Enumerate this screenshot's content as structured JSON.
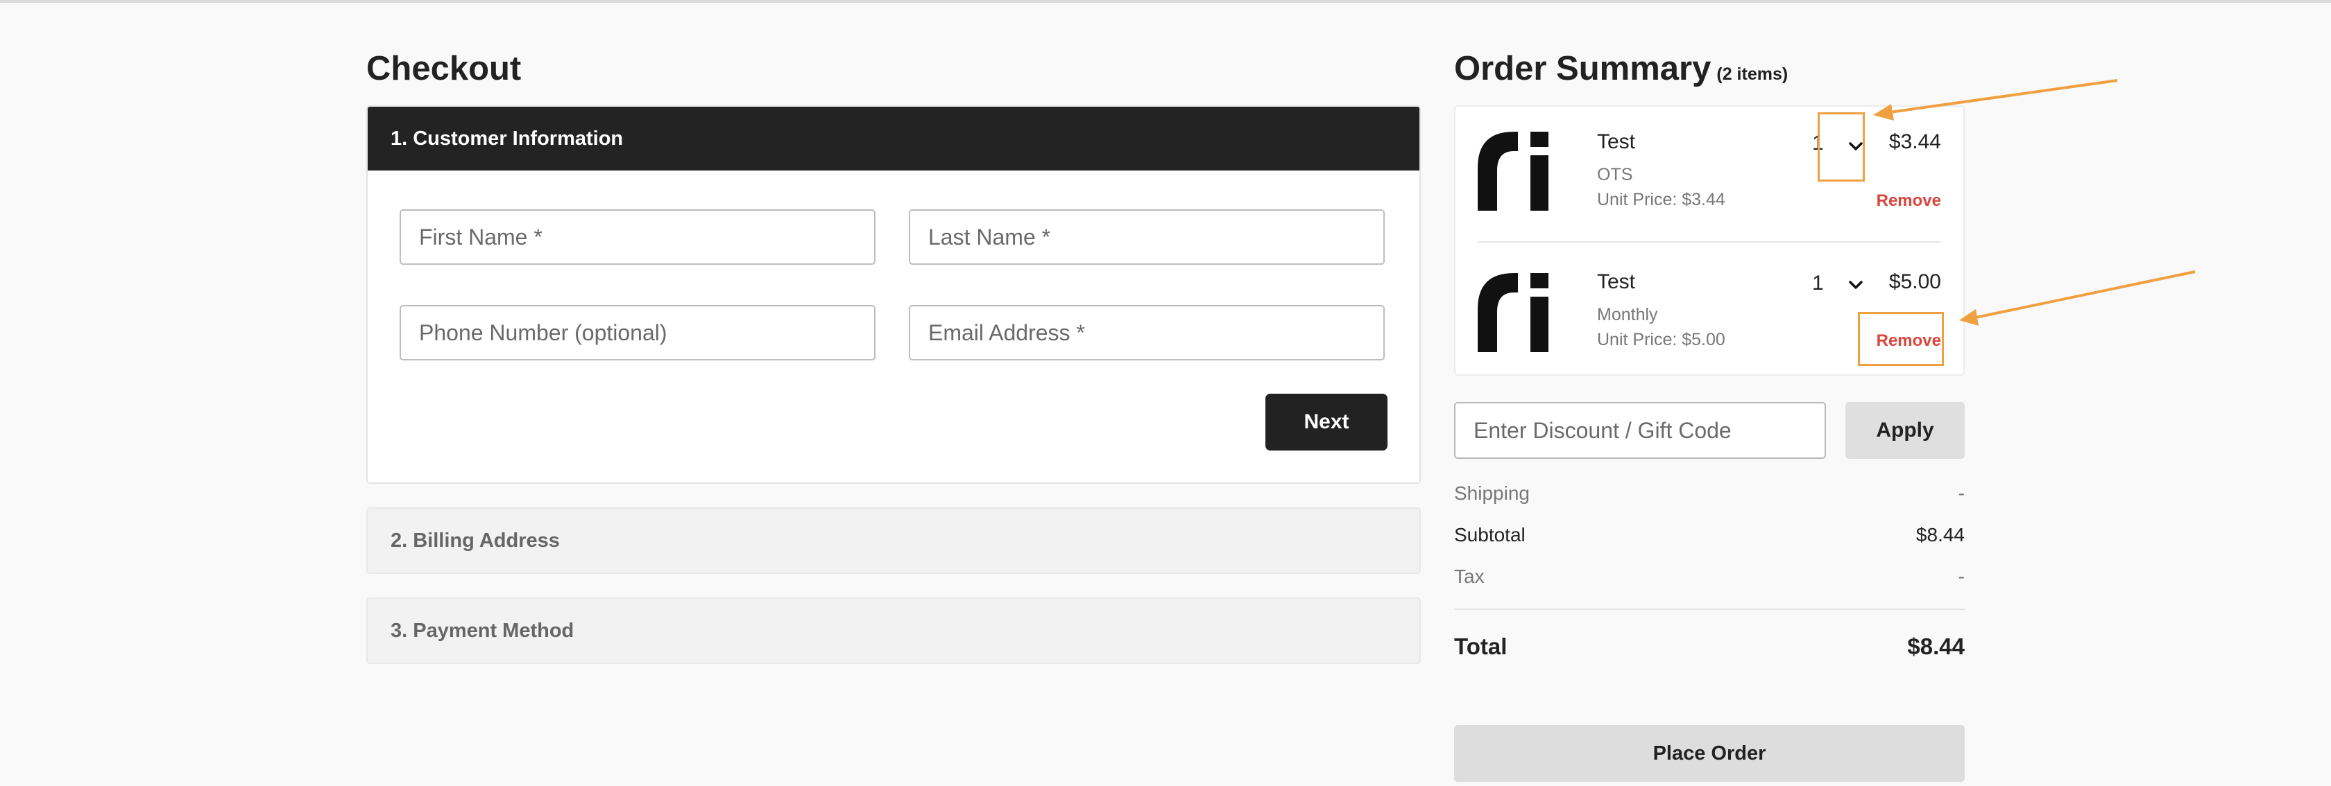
{
  "checkout": {
    "title": "Checkout",
    "steps": [
      {
        "label": "1. Customer Information",
        "state": "active"
      },
      {
        "label": "2. Billing Address",
        "state": "collapsed"
      },
      {
        "label": "3. Payment Method",
        "state": "collapsed"
      }
    ],
    "fields": {
      "first_name": "First Name *",
      "last_name": "Last Name *",
      "phone": "Phone Number (optional)",
      "email": "Email Address *"
    },
    "next_label": "Next"
  },
  "summary": {
    "title": "Order Summary",
    "count": "(2 items)",
    "items": [
      {
        "name": "Test",
        "plan": "OTS",
        "unit_price": "Unit Price: $3.44",
        "qty": "1",
        "price": "$3.44",
        "remove": "Remove"
      },
      {
        "name": "Test",
        "plan": "Monthly",
        "unit_price": "Unit Price: $5.00",
        "qty": "1",
        "price": "$5.00",
        "remove": "Remove"
      }
    ],
    "discount_placeholder": "Enter Discount / Gift Code",
    "apply_label": "Apply",
    "shipping_label": "Shipping",
    "shipping_value": "-",
    "subtotal_label": "Subtotal",
    "subtotal_value": "$8.44",
    "tax_label": "Tax",
    "tax_value": "-",
    "total_label": "Total",
    "total_value": "$8.44",
    "place_order_label": "Place Order"
  },
  "colors": {
    "accent_annotation": "#f0a040",
    "remove_red": "#d9463e",
    "dark_header": "#232323"
  }
}
